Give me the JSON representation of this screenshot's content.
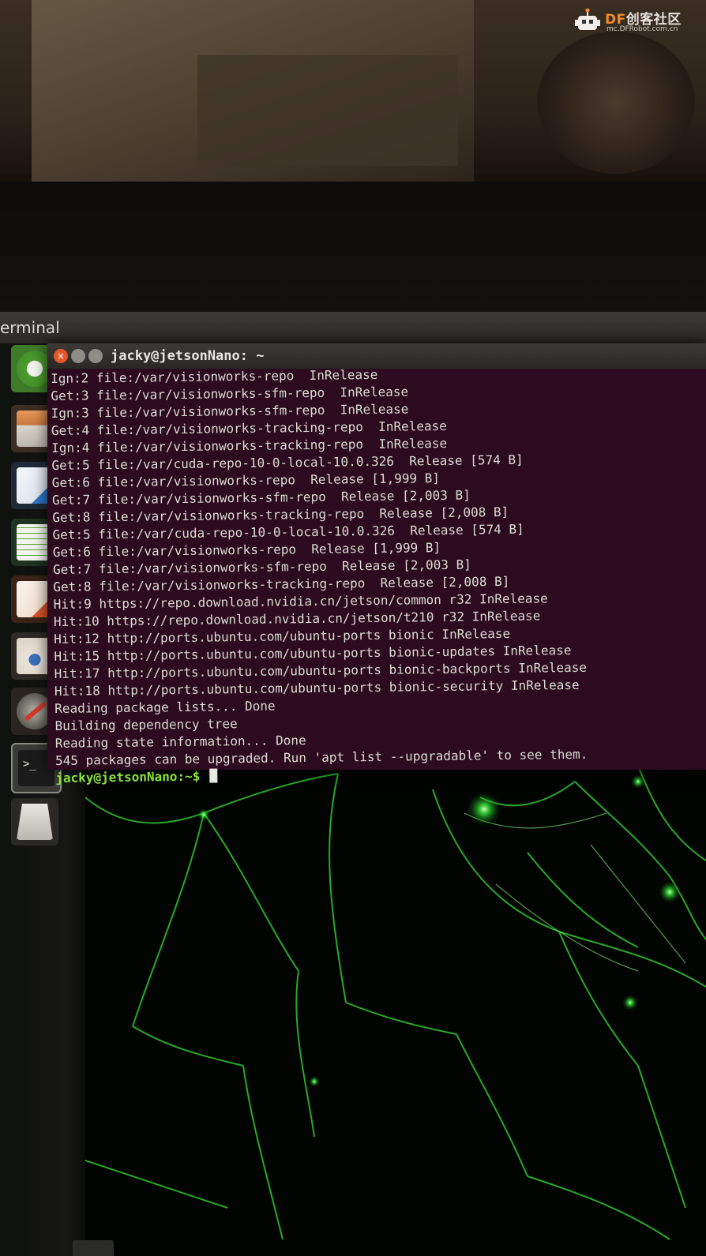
{
  "watermark": {
    "brand_prefix": "DF",
    "brand_name": "创客社区",
    "url": "mc.DFRobot.com.cn"
  },
  "topbar": {
    "app_title": "erminal"
  },
  "launcher": {
    "items": [
      {
        "name": "ubuntu-dash-icon"
      },
      {
        "name": "files-icon"
      },
      {
        "name": "libreoffice-writer-icon"
      },
      {
        "name": "libreoffice-calc-icon"
      },
      {
        "name": "libreoffice-impress-icon"
      },
      {
        "name": "software-center-icon"
      },
      {
        "name": "system-settings-icon"
      },
      {
        "name": "terminal-icon"
      },
      {
        "name": "trash-icon"
      }
    ]
  },
  "terminal": {
    "title": "jacky@jetsonNano: ~",
    "lines": [
      "Ign:2 file:/var/visionworks-repo  InRelease",
      "Get:3 file:/var/visionworks-sfm-repo  InRelease",
      "Ign:3 file:/var/visionworks-sfm-repo  InRelease",
      "Get:4 file:/var/visionworks-tracking-repo  InRelease",
      "Ign:4 file:/var/visionworks-tracking-repo  InRelease",
      "Get:5 file:/var/cuda-repo-10-0-local-10.0.326  Release [574 B]",
      "Get:6 file:/var/visionworks-repo  Release [1,999 B]",
      "Get:7 file:/var/visionworks-sfm-repo  Release [2,003 B]",
      "Get:8 file:/var/visionworks-tracking-repo  Release [2,008 B]",
      "Get:5 file:/var/cuda-repo-10-0-local-10.0.326  Release [574 B]",
      "Get:6 file:/var/visionworks-repo  Release [1,999 B]",
      "Get:7 file:/var/visionworks-sfm-repo  Release [2,003 B]",
      "Get:8 file:/var/visionworks-tracking-repo  Release [2,008 B]",
      "Hit:9 https://repo.download.nvidia.cn/jetson/common r32 InRelease",
      "Hit:10 https://repo.download.nvidia.cn/jetson/t210 r32 InRelease",
      "Hit:12 http://ports.ubuntu.com/ubuntu-ports bionic InRelease",
      "Hit:15 http://ports.ubuntu.com/ubuntu-ports bionic-updates InRelease",
      "Hit:17 http://ports.ubuntu.com/ubuntu-ports bionic-backports InRelease",
      "Hit:18 http://ports.ubuntu.com/ubuntu-ports bionic-security InRelease",
      "Reading package lists... Done",
      "Building dependency tree",
      "Reading state information... Done",
      "545 packages can be upgraded. Run 'apt list --upgradable' to see them."
    ],
    "prompt": "jacky@jetsonNano:~$"
  },
  "colors": {
    "terminal_bg": "#2c0b1e",
    "prompt_green": "#8ae234",
    "close_button": "#e4572a",
    "wallpaper_glow": "#39ff3a"
  }
}
